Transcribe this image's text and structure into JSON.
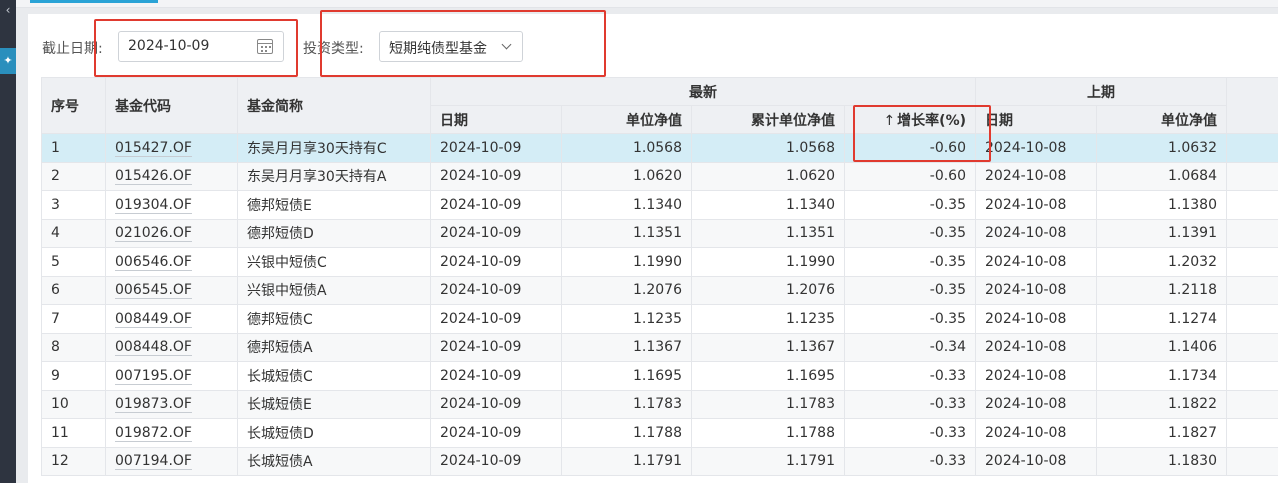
{
  "filters": {
    "date_label": "截止日期:",
    "date_value": "2024-10-09",
    "type_label": "投资类型:",
    "type_value": "短期纯债型基金"
  },
  "table": {
    "col_seq": "序号",
    "col_code": "基金代码",
    "col_name": "基金简称",
    "group_latest": "最新",
    "group_prev": "上期",
    "sub_date": "日期",
    "sub_nav": "单位净值",
    "sub_acc_nav": "累计单位净值",
    "sub_growth": "增长率(%)",
    "sort_arrow": "↑",
    "prev_date": "日期",
    "prev_nav": "单位净值",
    "rows": [
      {
        "seq": "1",
        "code": "015427.OF",
        "name": "东吴月月享30天持有C",
        "date": "2024-10-09",
        "nav": "1.0568",
        "acc": "1.0568",
        "growth": "-0.60",
        "pdate": "2024-10-08",
        "pnav": "1.0632"
      },
      {
        "seq": "2",
        "code": "015426.OF",
        "name": "东吴月月享30天持有A",
        "date": "2024-10-09",
        "nav": "1.0620",
        "acc": "1.0620",
        "growth": "-0.60",
        "pdate": "2024-10-08",
        "pnav": "1.0684"
      },
      {
        "seq": "3",
        "code": "019304.OF",
        "name": "德邦短债E",
        "date": "2024-10-09",
        "nav": "1.1340",
        "acc": "1.1340",
        "growth": "-0.35",
        "pdate": "2024-10-08",
        "pnav": "1.1380"
      },
      {
        "seq": "4",
        "code": "021026.OF",
        "name": "德邦短债D",
        "date": "2024-10-09",
        "nav": "1.1351",
        "acc": "1.1351",
        "growth": "-0.35",
        "pdate": "2024-10-08",
        "pnav": "1.1391"
      },
      {
        "seq": "5",
        "code": "006546.OF",
        "name": "兴银中短债C",
        "date": "2024-10-09",
        "nav": "1.1990",
        "acc": "1.1990",
        "growth": "-0.35",
        "pdate": "2024-10-08",
        "pnav": "1.2032"
      },
      {
        "seq": "6",
        "code": "006545.OF",
        "name": "兴银中短债A",
        "date": "2024-10-09",
        "nav": "1.2076",
        "acc": "1.2076",
        "growth": "-0.35",
        "pdate": "2024-10-08",
        "pnav": "1.2118"
      },
      {
        "seq": "7",
        "code": "008449.OF",
        "name": "德邦短债C",
        "date": "2024-10-09",
        "nav": "1.1235",
        "acc": "1.1235",
        "growth": "-0.35",
        "pdate": "2024-10-08",
        "pnav": "1.1274"
      },
      {
        "seq": "8",
        "code": "008448.OF",
        "name": "德邦短债A",
        "date": "2024-10-09",
        "nav": "1.1367",
        "acc": "1.1367",
        "growth": "-0.34",
        "pdate": "2024-10-08",
        "pnav": "1.1406"
      },
      {
        "seq": "9",
        "code": "007195.OF",
        "name": "长城短债C",
        "date": "2024-10-09",
        "nav": "1.1695",
        "acc": "1.1695",
        "growth": "-0.33",
        "pdate": "2024-10-08",
        "pnav": "1.1734"
      },
      {
        "seq": "10",
        "code": "019873.OF",
        "name": "长城短债E",
        "date": "2024-10-09",
        "nav": "1.1783",
        "acc": "1.1783",
        "growth": "-0.33",
        "pdate": "2024-10-08",
        "pnav": "1.1822"
      },
      {
        "seq": "11",
        "code": "019872.OF",
        "name": "长城短债D",
        "date": "2024-10-09",
        "nav": "1.1788",
        "acc": "1.1788",
        "growth": "-0.33",
        "pdate": "2024-10-08",
        "pnav": "1.1827"
      },
      {
        "seq": "12",
        "code": "007194.OF",
        "name": "长城短债A",
        "date": "2024-10-09",
        "nav": "1.1791",
        "acc": "1.1791",
        "growth": "-0.33",
        "pdate": "2024-10-08",
        "pnav": "1.1830"
      }
    ]
  },
  "colors": {
    "selected_row": "#d4edf6",
    "header_bg": "#eef0f3",
    "annotation_red": "#e03a2f"
  }
}
